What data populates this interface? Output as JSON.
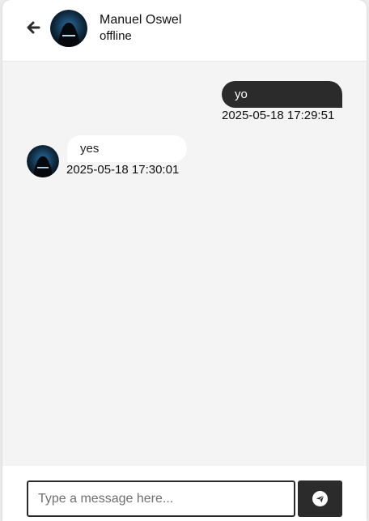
{
  "header": {
    "contact_name": "Manuel Oswel",
    "contact_status": "offline",
    "back_icon": "arrow-left-icon",
    "avatar_icon": "hooded-figure-avatar"
  },
  "messages": [
    {
      "direction": "outgoing",
      "text": "yo",
      "time": "2025-05-18 17:29:51"
    },
    {
      "direction": "incoming",
      "text": "yes",
      "time": "2025-05-18 17:30:01"
    }
  ],
  "composer": {
    "placeholder": "Type a message here...",
    "value": "",
    "send_icon": "paper-plane-icon"
  },
  "colors": {
    "accent": "#2b2b2b",
    "background": "#f4f4f4",
    "surface": "#ffffff"
  }
}
